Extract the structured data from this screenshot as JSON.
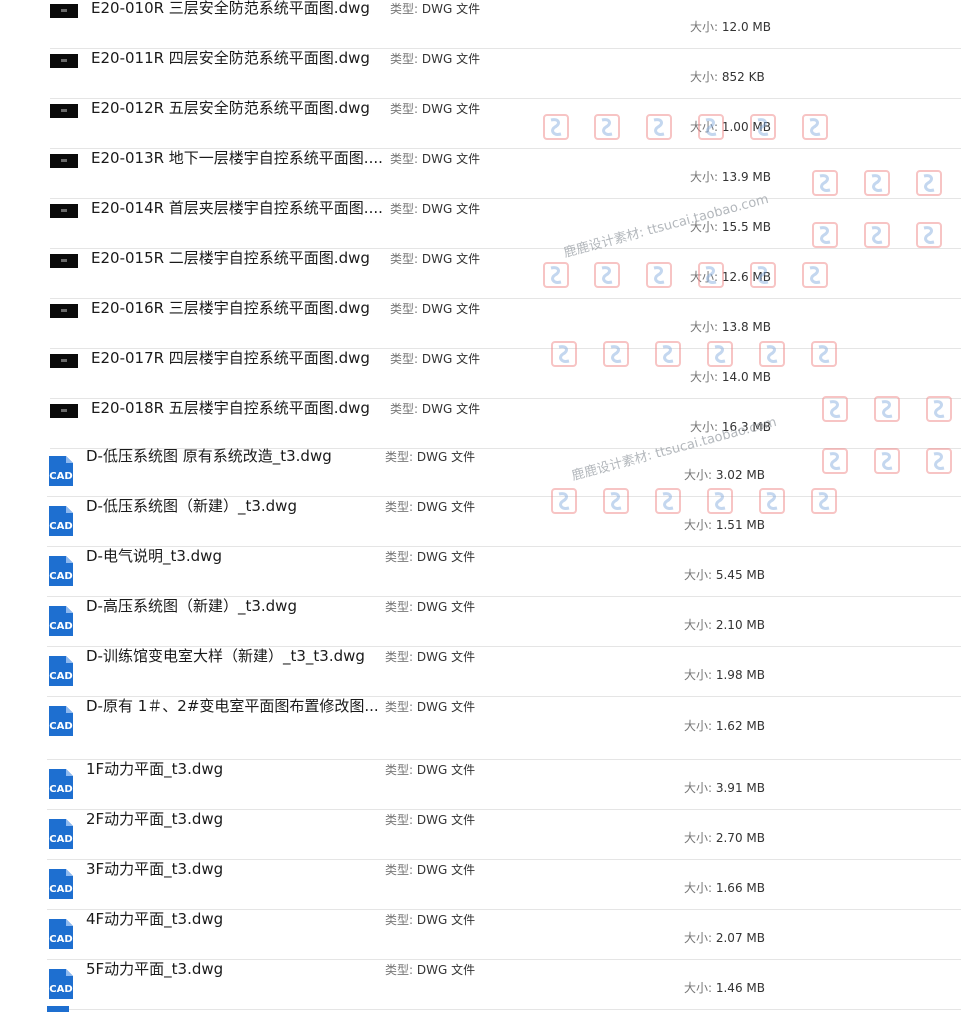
{
  "labels": {
    "type_key": "类型:",
    "size_key": "大小:"
  },
  "icons": {
    "cad_file": "cad-file-icon",
    "dwg_thumb": "dwg-thumbnail"
  },
  "colors": {
    "cad_blue": "#1e6fd0",
    "separator": "#e5e5e5",
    "watermark": "#f0a0a0"
  },
  "watermark": {
    "text": "鹿鹿设计素材: ttsucai.taobao.com"
  },
  "files": [
    {
      "name": "E20-010R 三层安全防范系统平面图.dwg",
      "type": "DWG 文件",
      "size": "12.0 MB",
      "icon": "thumb"
    },
    {
      "name": "E20-011R 四层安全防范系统平面图.dwg",
      "type": "DWG 文件",
      "size": "852 KB",
      "icon": "thumb"
    },
    {
      "name": "E20-012R 五层安全防范系统平面图.dwg",
      "type": "DWG 文件",
      "size": "1.00 MB",
      "icon": "thumb"
    },
    {
      "name": "E20-013R 地下一层楼宇自控系统平面图....",
      "type": "DWG 文件",
      "size": "13.9 MB",
      "icon": "thumb"
    },
    {
      "name": "E20-014R 首层夹层楼宇自控系统平面图....",
      "type": "DWG 文件",
      "size": "15.5 MB",
      "icon": "thumb"
    },
    {
      "name": "E20-015R 二层楼宇自控系统平面图.dwg",
      "type": "DWG 文件",
      "size": "12.6 MB",
      "icon": "thumb"
    },
    {
      "name": "E20-016R 三层楼宇自控系统平面图.dwg",
      "type": "DWG 文件",
      "size": "13.8 MB",
      "icon": "thumb"
    },
    {
      "name": "E20-017R 四层楼宇自控系统平面图.dwg",
      "type": "DWG 文件",
      "size": "14.0 MB",
      "icon": "thumb"
    },
    {
      "name": "E20-018R 五层楼宇自控系统平面图.dwg",
      "type": "DWG 文件",
      "size": "16.3 MB",
      "icon": "thumb"
    },
    {
      "name": "D-低压系统图 原有系统改造_t3.dwg",
      "type": "DWG 文件",
      "size": "3.02 MB",
      "icon": "cad"
    },
    {
      "name": "D-低压系统图（新建）_t3.dwg",
      "type": "DWG 文件",
      "size": "1.51 MB",
      "icon": "cad"
    },
    {
      "name": "D-电气说明_t3.dwg",
      "type": "DWG 文件",
      "size": "5.45 MB",
      "icon": "cad"
    },
    {
      "name": "D-高压系统图（新建）_t3.dwg",
      "type": "DWG 文件",
      "size": "2.10 MB",
      "icon": "cad"
    },
    {
      "name": "D-训练馆变电室大样（新建）_t3_t3.dwg",
      "type": "DWG 文件",
      "size": "1.98 MB",
      "icon": "cad"
    },
    {
      "name": "D-原有 1＃、2#变电室平面图布置修改图...",
      "type": "DWG 文件",
      "size": "1.62 MB",
      "icon": "cad"
    },
    {
      "name": "1F动力平面_t3.dwg",
      "type": "DWG 文件",
      "size": "3.91 MB",
      "icon": "cad"
    },
    {
      "name": "2F动力平面_t3.dwg",
      "type": "DWG 文件",
      "size": "2.70 MB",
      "icon": "cad"
    },
    {
      "name": "3F动力平面_t3.dwg",
      "type": "DWG 文件",
      "size": "1.66 MB",
      "icon": "cad"
    },
    {
      "name": "4F动力平面_t3.dwg",
      "type": "DWG 文件",
      "size": "2.07 MB",
      "icon": "cad"
    },
    {
      "name": "5F动力平面_t3.dwg",
      "type": "DWG 文件",
      "size": "1.46 MB",
      "icon": "cad"
    }
  ]
}
